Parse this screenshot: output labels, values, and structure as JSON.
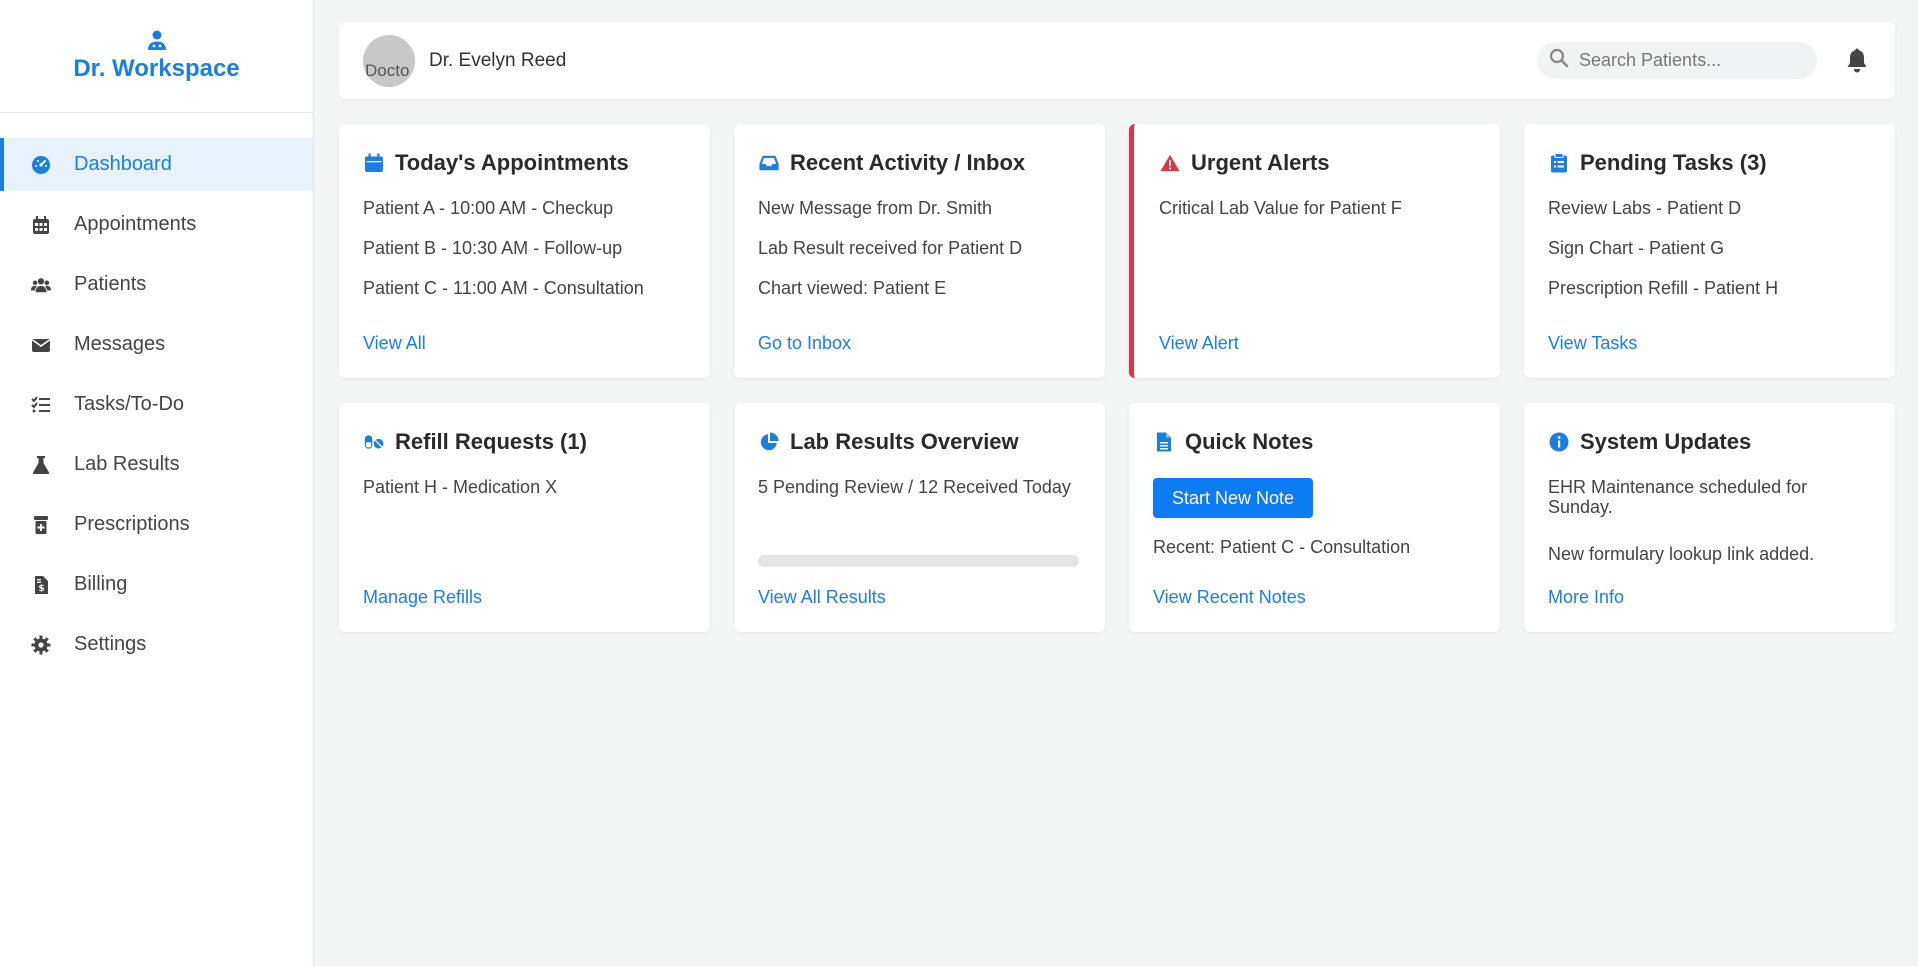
{
  "brand": {
    "name": "Dr. Workspace",
    "icon": "doctor-icon"
  },
  "sidebar": {
    "items": [
      {
        "label": "Dashboard",
        "icon": "dashboard-icon",
        "active": true
      },
      {
        "label": "Appointments",
        "icon": "calendar-icon"
      },
      {
        "label": "Patients",
        "icon": "users-icon"
      },
      {
        "label": "Messages",
        "icon": "envelope-icon"
      },
      {
        "label": "Tasks/To-Do",
        "icon": "tasks-icon"
      },
      {
        "label": "Lab Results",
        "icon": "flask-icon"
      },
      {
        "label": "Prescriptions",
        "icon": "prescription-bottle-icon"
      },
      {
        "label": "Billing",
        "icon": "invoice-icon"
      },
      {
        "label": "Settings",
        "icon": "gear-icon"
      }
    ]
  },
  "header": {
    "avatar_alt": "Docto",
    "doctor_name": "Dr. Evelyn Reed",
    "search_placeholder": "Search Patients...",
    "search_value": ""
  },
  "cards": {
    "appointments": {
      "title": "Today's Appointments",
      "items": [
        "Patient A - 10:00 AM - Checkup",
        "Patient B - 10:30 AM - Follow-up",
        "Patient C - 11:00 AM - Consultation"
      ],
      "link": "View All"
    },
    "activity": {
      "title": "Recent Activity / Inbox",
      "items": [
        "New Message from Dr. Smith",
        "Lab Result received for Patient D",
        "Chart viewed: Patient E"
      ],
      "link": "Go to Inbox"
    },
    "alerts": {
      "title": "Urgent Alerts",
      "items": [
        "Critical Lab Value for Patient F"
      ],
      "link": "View Alert"
    },
    "tasks": {
      "title": "Pending Tasks (3)",
      "items": [
        "Review Labs - Patient D",
        "Sign Chart - Patient G",
        "Prescription Refill - Patient H"
      ],
      "link": "View Tasks"
    },
    "refills": {
      "title": "Refill Requests (1)",
      "items": [
        "Patient H - Medication X"
      ],
      "link": "Manage Refills"
    },
    "labs": {
      "title": "Lab Results Overview",
      "summary": "5 Pending Review / 12 Received Today",
      "progress": 0,
      "link": "View All Results"
    },
    "notes": {
      "title": "Quick Notes",
      "button": "Start New Note",
      "recent": "Recent: Patient C - Consultation",
      "link": "View Recent Notes"
    },
    "updates": {
      "title": "System Updates",
      "items": [
        "EHR Maintenance scheduled for Sunday.",
        "New formulary lookup link added."
      ],
      "link": "More Info"
    }
  },
  "colors": {
    "accent": "#1a7fe0",
    "danger": "#dc3545",
    "button": "#0b7cf3"
  }
}
